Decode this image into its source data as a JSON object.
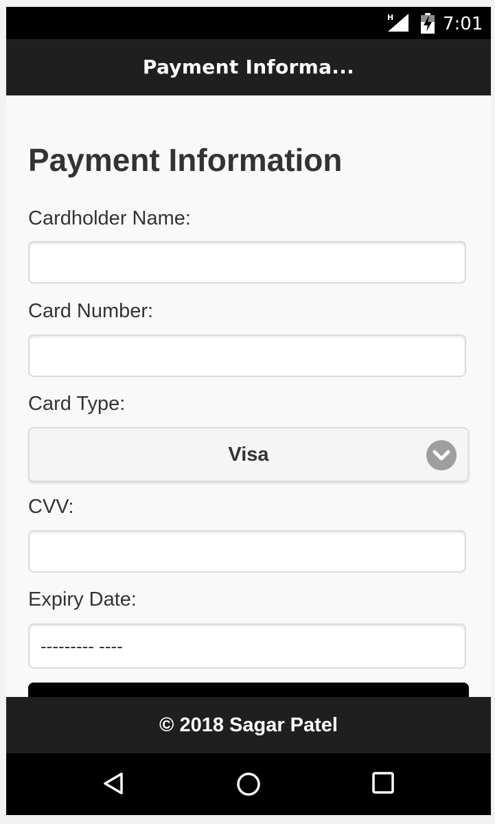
{
  "status_bar": {
    "network_type": "H",
    "time": "7:01"
  },
  "header": {
    "title": "Payment Informa..."
  },
  "form": {
    "heading": "Payment Information",
    "cardholder_label": "Cardholder Name:",
    "cardholder_value": "",
    "card_number_label": "Card Number:",
    "card_number_value": "",
    "card_type_label": "Card Type:",
    "card_type_value": "Visa",
    "cvv_label": "CVV:",
    "cvv_value": "",
    "expiry_label": "Expiry Date:",
    "expiry_placeholder": "--------- ----"
  },
  "footer": {
    "text": "© 2018 Sagar Patel"
  },
  "icons": {
    "signal": "signal-icon",
    "battery": "battery-charging-icon",
    "select_arrow": "chevron-down-icon",
    "back": "back-icon",
    "home": "home-icon",
    "recents": "recents-icon"
  },
  "colors": {
    "status_bar": "#000000",
    "header": "#1f1f1f",
    "footer": "#1f1f1f",
    "page_background": "#f9f9f9",
    "submit_button": "#000000"
  }
}
